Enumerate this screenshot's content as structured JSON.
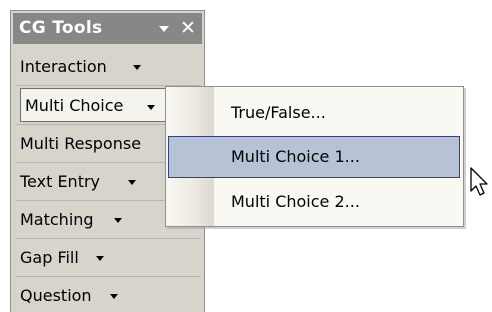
{
  "toolbar": {
    "title": "CG Tools",
    "icons": {
      "dropdown": "chevron-down-icon",
      "close": "close-icon"
    },
    "close_glyph": "✕",
    "items": [
      {
        "label": "Interaction",
        "has_dropdown": true
      },
      {
        "label": "Multi Choice",
        "has_dropdown": true,
        "active": true
      },
      {
        "label": "Multi Response",
        "has_dropdown": true
      },
      {
        "label": "Text Entry",
        "has_dropdown": true
      },
      {
        "label": "Matching",
        "has_dropdown": true
      },
      {
        "label": "Gap Fill",
        "has_dropdown": true
      },
      {
        "label": "Question",
        "has_dropdown": true
      }
    ]
  },
  "menu": {
    "items": [
      {
        "label": "True/False..."
      },
      {
        "label": "Multi Choice 1...",
        "selected": true
      },
      {
        "label": "Multi Choice 2..."
      }
    ]
  },
  "cursor": {
    "icon": "mouse-pointer-icon"
  },
  "colors": {
    "toolbar_bg": "#d7d4cc",
    "titlebar_bg": "#878787",
    "menu_bg": "#f9f8f3",
    "menu_highlight": "#b7c2d7",
    "menu_highlight_border": "#31457d"
  }
}
